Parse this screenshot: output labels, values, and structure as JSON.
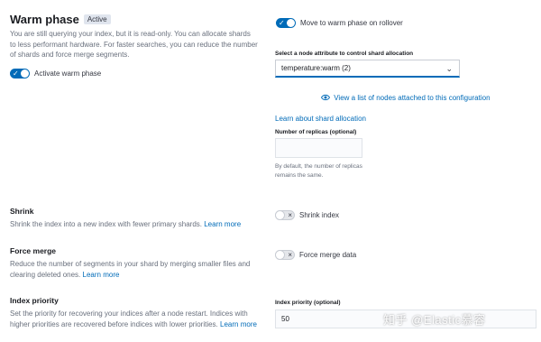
{
  "warm_phase": {
    "title": "Warm phase",
    "badge": "Active",
    "description": "You are still querying your index, but it is read-only. You can allocate shards to less performant hardware. For faster searches, you can reduce the number of shards and force merge segments.",
    "activate_toggle": {
      "label": "Activate warm phase",
      "checked": true
    },
    "rollover_toggle": {
      "label": "Move to warm phase on rollover",
      "checked": true
    },
    "node_attribute": {
      "label": "Select a node attribute to control shard allocation",
      "value": "temperature:warm (2)",
      "view_nodes_link": "View a list of nodes attached to this configuration"
    },
    "learn_shard_allocation_link": "Learn about shard allocation",
    "replicas": {
      "label": "Number of replicas (optional)",
      "value": "",
      "help": "By default, the number of replicas remains the same."
    }
  },
  "shrink": {
    "title": "Shrink",
    "description": "Shrink the index into a new index with fewer primary shards.",
    "learn_more": "Learn more",
    "toggle": {
      "label": "Shrink index",
      "checked": false
    }
  },
  "force_merge": {
    "title": "Force merge",
    "description": "Reduce the number of segments in your shard by merging smaller files and clearing deleted ones.",
    "learn_more": "Learn more",
    "toggle": {
      "label": "Force merge data",
      "checked": false
    }
  },
  "index_priority": {
    "title": "Index priority",
    "description": "Set the priority for recovering your indices after a node restart. Indices with higher priorities are recovered before indices with lower priorities.",
    "learn_more": "Learn more",
    "field_label": "Index priority (optional)",
    "value": "50"
  },
  "watermark": "知乎 @Elastic慕容",
  "colors": {
    "accent": "#006bb8",
    "text": "#343741",
    "subdued": "#69707d"
  },
  "icons": {
    "toggle_on": "check-icon",
    "toggle_off": "cross-icon",
    "eye": "eye-icon",
    "chevron": "chevron-down-icon"
  }
}
